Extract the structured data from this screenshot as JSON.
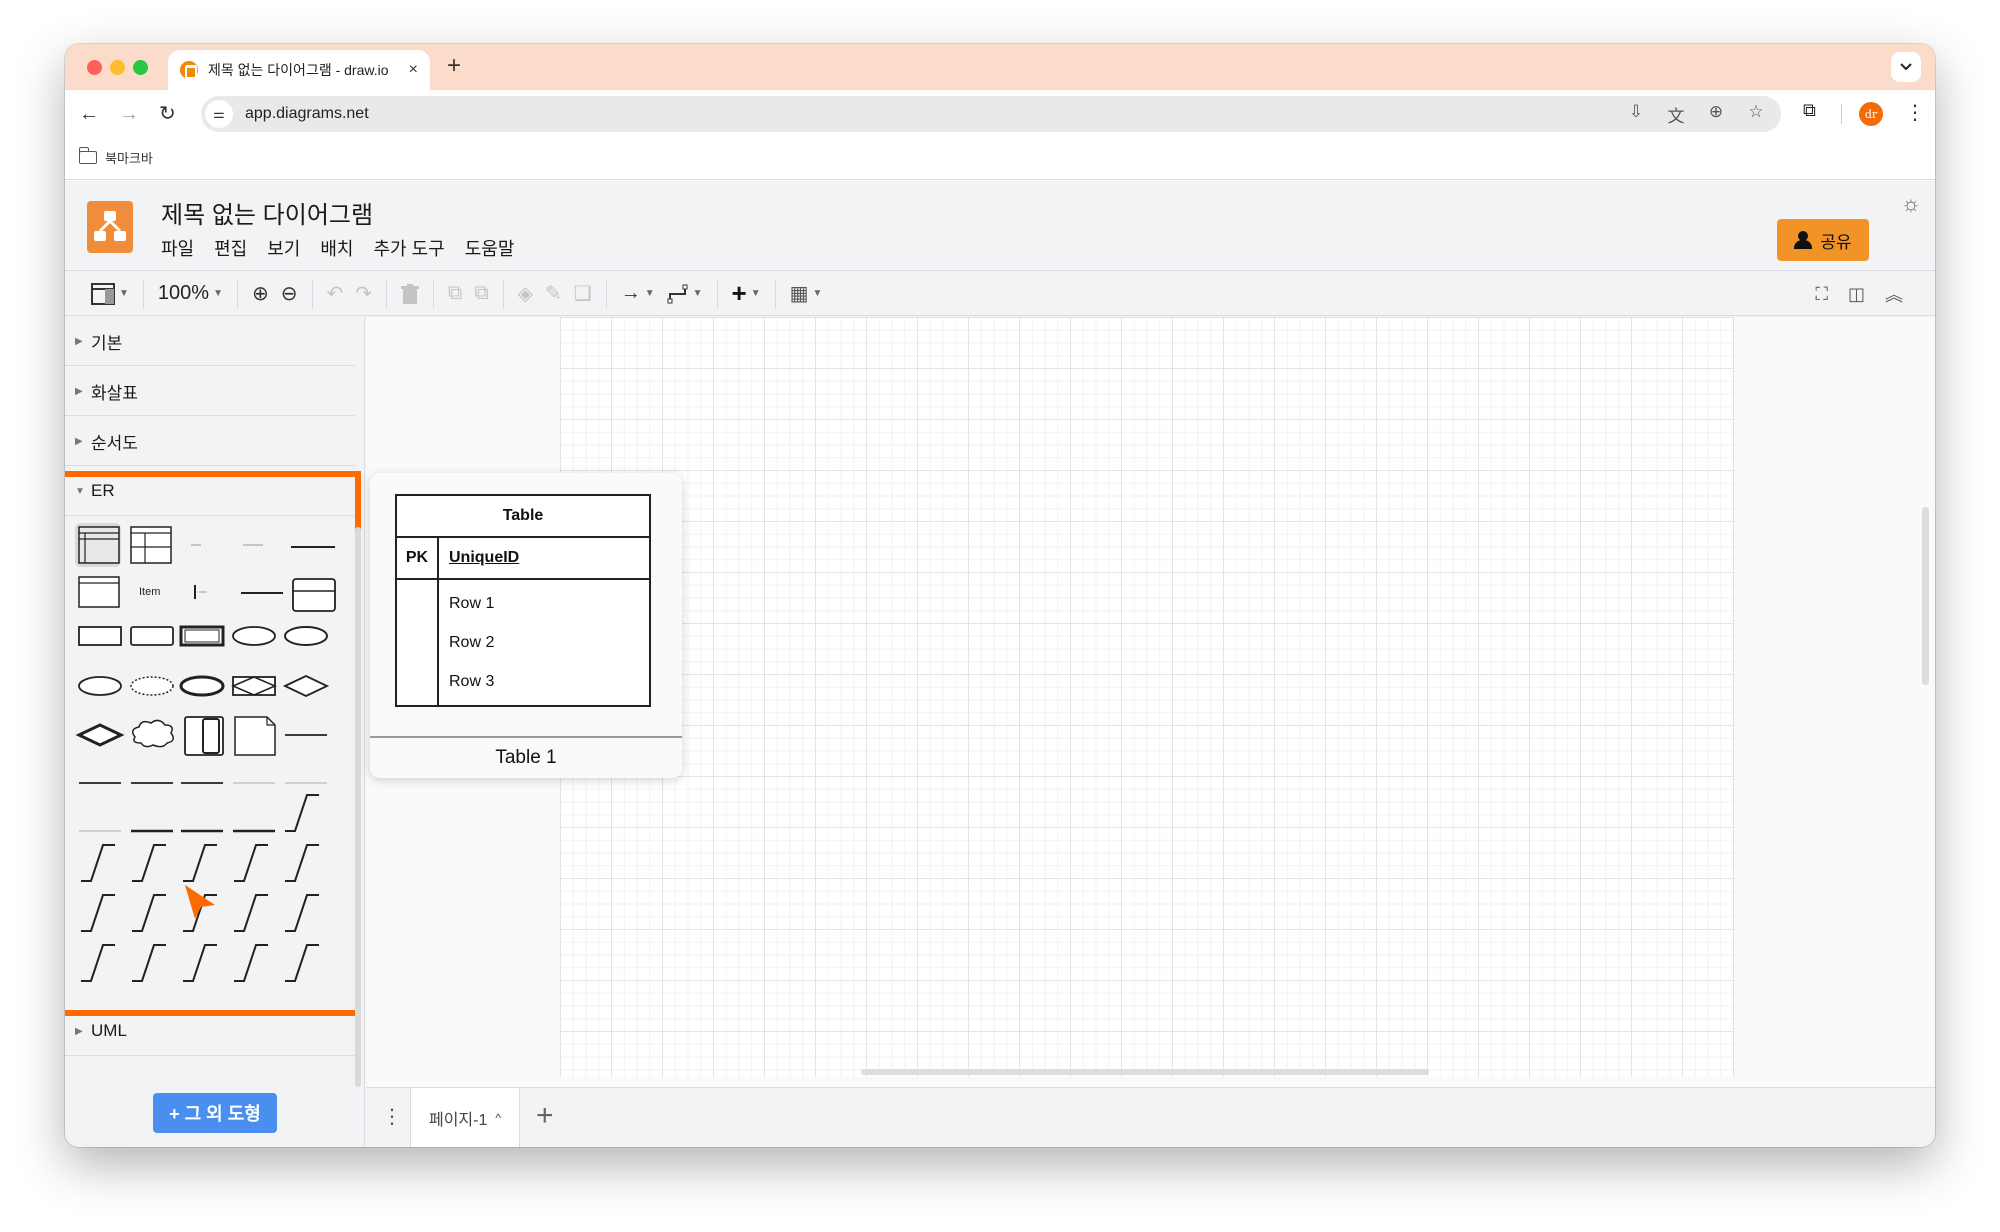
{
  "browser": {
    "tab": {
      "title": "제목 없는 다이어그램 - draw.io",
      "close_glyph": "×"
    },
    "new_tab_glyph": "+",
    "tab_menu_glyph": "⌄",
    "nav": {
      "back": "←",
      "forward": "→",
      "reload": "↻"
    },
    "url": "app.diagrams.net",
    "omnibox_icons": [
      "install-app-icon",
      "translate-icon",
      "zoom-icon",
      "bookmark-star-icon"
    ],
    "omnibox_glyphs": [
      "⇩",
      "文",
      "⊕",
      "☆"
    ],
    "extensions_glyph": "⧉",
    "profile_initials": "dr",
    "menu_glyph": "⋮",
    "bookmarks": [
      {
        "label": "북마크바"
      }
    ]
  },
  "app": {
    "title": "제목 없는 다이어그램",
    "menu": [
      "파일",
      "편집",
      "보기",
      "배치",
      "추가 도구",
      "도움말"
    ],
    "share_label": "공유",
    "theme_glyph": "☼",
    "brand_color": "#f08c3a",
    "share_color": "#f19326",
    "highlight_color": "#ff6a00",
    "toolbar": {
      "zoom": "100%",
      "format_panel_glyph": "▥",
      "zoom_in_glyph": "⊕",
      "zoom_out_glyph": "⊖",
      "undo_glyph": "↶",
      "redo_glyph": "↷",
      "delete_glyph": "🗑",
      "to_front_glyph": "⧉",
      "to_back_glyph": "⧉",
      "fill_glyph": "◈",
      "line_color_glyph": "✎",
      "shadow_glyph": "❑",
      "connection_glyph": "→",
      "waypoint_glyph": "⌐",
      "insert_glyph": "+",
      "table_glyph": "▦",
      "caret": "▼",
      "fullscreen_glyph": "⛶",
      "format_toggle_glyph": "◫",
      "collapse_glyph": "︽"
    },
    "sidebar": {
      "sections": [
        {
          "label": "기본",
          "expanded": false
        },
        {
          "label": "화살표",
          "expanded": false
        },
        {
          "label": "순서도",
          "expanded": false
        },
        {
          "label": "ER",
          "expanded": true
        },
        {
          "label": "UML",
          "expanded": false
        }
      ],
      "collapsed_glyph": "▶",
      "expanded_glyph": "▼",
      "er_shape_labels": {
        "item": "Item"
      },
      "more_shapes_label": "+ 그 외 도형"
    },
    "preview": {
      "table_title": "Table",
      "pk_label": "PK",
      "pk_field": "UniqueID",
      "rows": [
        "Row 1",
        "Row 2",
        "Row 3"
      ],
      "caption": "Table 1"
    },
    "pages": {
      "menu_glyph": "⋮",
      "tabs": [
        {
          "label": "페이지-1",
          "glyph": "^"
        }
      ],
      "add_glyph": "+"
    }
  }
}
